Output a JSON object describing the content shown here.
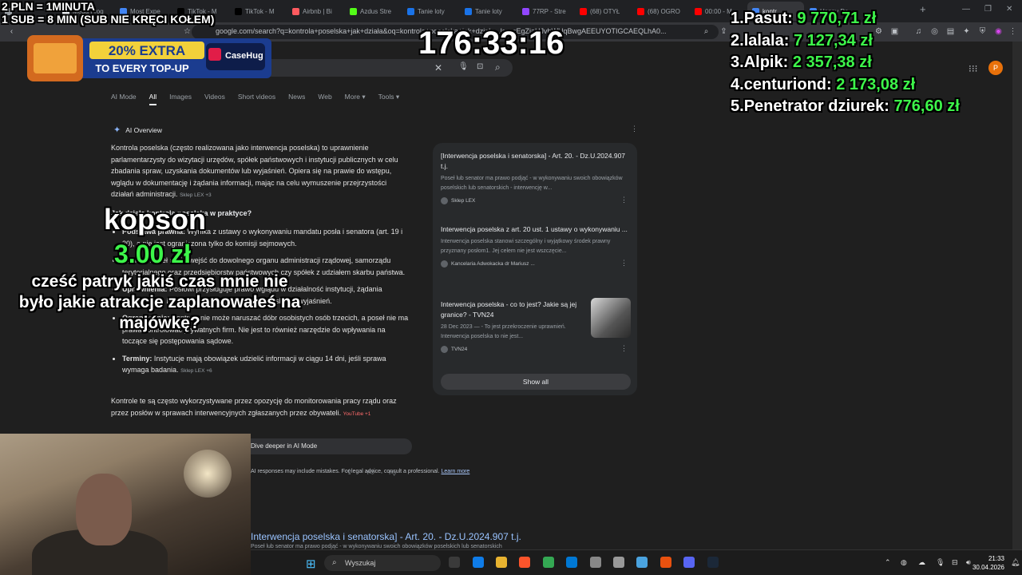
{
  "browser": {
    "tabs": [
      {
        "label": "",
        "color": "#9aa0a6"
      },
      {
        "label": "Mega Frog",
        "color": "#e8eaed"
      },
      {
        "label": "Most Expe",
        "color": "#4285f4"
      },
      {
        "label": "TikTok - M",
        "color": "#000000"
      },
      {
        "label": "TikTok - M",
        "color": "#000000"
      },
      {
        "label": "Airbnb | Bi",
        "color": "#ff5a5f"
      },
      {
        "label": "Azdus Stre",
        "color": "#53fc18"
      },
      {
        "label": "Tanie loty",
        "color": "#1a73e8"
      },
      {
        "label": "Tanie loty",
        "color": "#1a73e8"
      },
      {
        "label": "77RP - Stre",
        "color": "#9146ff"
      },
      {
        "label": "(68) OTYŁ",
        "color": "#ff0000"
      },
      {
        "label": "(68) OGRO",
        "color": "#ff0000"
      },
      {
        "label": "00:00 - M",
        "color": "#ff0000"
      },
      {
        "label": "kontr",
        "color": "#4285f4",
        "active": true
      },
      {
        "label": "Happy Do",
        "color": "#4285f4"
      }
    ],
    "url": "google.com/search?q=kontrola+poselska+jak+działa&oq=kontrola+poselska+jak+działa...lcrp=EgZjaHJvbWUqBwgAEEUYOTIGCAEQLhA0...",
    "new_tab": "+"
  },
  "google": {
    "nav_tabs": [
      "AI Mode",
      "All",
      "Images",
      "Videos",
      "Short videos",
      "News",
      "Web",
      "More ▾",
      "Tools ▾"
    ],
    "ai_overview_title": "AI Overview",
    "intro": "Kontrola poselska (często realizowana jako interwencja poselska) to uprawnienie parlamentarzysty do wizytacji urzędów, spółek państwowych i instytucji publicznych w celu zbadania spraw, uzyskania dokumentów lub wyjaśnień. Opiera się na prawie do wstępu, wglądu w dokumentację i żądania informacji, mając na celu wymuszenie przejrzystości działań administracji.",
    "intro_cite": "Sklep LEX +3",
    "subheading": "Jak działa kontrola poselska w praktyce?",
    "bullets": [
      {
        "term": "Podstawa prawna:",
        "text": "Wynika z ustawy o wykonywaniu mandatu posła i senatora (art. 19 i 20), a nie jest ograniczona tylko do komisji sejmowych."
      },
      {
        "term": "Zakres:",
        "text": "Poseł może wejść do dowolnego organu administracji rządowej, samorządu terytorialnego oraz przedsiębiorstw państwowych czy spółek z udziałem skarbu państwa."
      },
      {
        "term": "Uprawnienia:",
        "text": "Posłowi przysługuje prawo wglądu w działalność instytucji, żądania dokumentów, informacji oraz niezwłocznego uzyskania wyjaśnień."
      },
      {
        "term": "Ograniczenia:",
        "text": "Kontrola nie może naruszać dóbr osobistych osób trzecich, a poseł nie ma prawa kontrolować prywatnych firm. Nie jest to również narzędzie do wpływania na toczące się postępowania sądowe."
      },
      {
        "term": "Terminy:",
        "text": "Instytucje mają obowiązek udzielić informacji w ciągu 14 dni, jeśli sprawa wymaga badania.",
        "cite": "Sklep LEX +6"
      }
    ],
    "closing": "Kontrole te są często wykorzystywane przez opozycję do monitorowania pracy rządu oraz przez posłów w sprawach interwencyjnych zgłaszanych przez obywateli.",
    "closing_cite": "YouTube +1",
    "deeper_label": "Dive deeper in AI Mode",
    "disclaimer": "AI responses may include mistakes. For legal advice, consult a professional.",
    "learn_more": "Learn more",
    "result_title": "Interwencja poselska i senatorska] - Art. 20. - Dz.U.2024.907 t.j.",
    "result_snippet": "Poseł lub senator ma prawo podjąć - w wykonywaniu swoich obowiązków poselskich lub senatorskich",
    "sources": [
      {
        "title": "[Interwencja poselska i senatorska] - Art. 20. - Dz.U.2024.907 t.j.",
        "snippet": "Poseł lub senator ma prawo podjąć - w wykonywaniu swoich obowiązków poselskich lub senatorskich - interwencję w...",
        "origin": "Sklep LEX"
      },
      {
        "title": "Interwencja poselska z art. 20 ust. 1 ustawy o wykonywaniu ...",
        "snippet": "Interwencja poselska stanowi szczególny i wyjątkowy środek prawny przyznany posłom1. Jej celem nie jest wszczęcie...",
        "origin": "Kancelaria Adwokacka dr Mariusz ..."
      },
      {
        "title": "Interwencja poselska - co to jest? Jakie są jej granice? - TVN24",
        "snippet": "28 Dec 2023 — - To jest przekroczenie uprawnień. Interwencja poselska to nie jest...",
        "origin": "TVN24"
      }
    ],
    "show_all": "Show all",
    "avatar_letter": "P"
  },
  "taskbar": {
    "search_placeholder": "Wyszukaj",
    "time": "21:33",
    "date": "30.04.2026",
    "app_colors": [
      "#3a3a3a",
      "#0f7ce8",
      "#e8b330",
      "#fb542b",
      "#34a853",
      "#0078d4",
      "#888888",
      "#999999",
      "#4aa3df",
      "#e8510f",
      "#5865f2",
      "#1b2838"
    ]
  },
  "overlay": {
    "top_info_line1": "2 PLN = 1MINUTA",
    "top_info_line2": "1 SUB = 8 MIN (SUB NIE KRĘCI KOŁEM)",
    "timer": "176:33:16",
    "promo_main": "20% EXTRA",
    "promo_sub": "TO EVERY TOP-UP",
    "promo_brand": "CaseHug",
    "leaderboard": [
      {
        "rank": "1.",
        "name": "Pasut:",
        "amount": "9 770,71 zł"
      },
      {
        "rank": "2.",
        "name": "lalala:",
        "amount": "7 127,34 zł"
      },
      {
        "rank": "3.",
        "name": "Alpik:",
        "amount": "2 357,38 zł"
      },
      {
        "rank": "4.",
        "name": "centuriond:",
        "amount": "2 173,08 zł"
      },
      {
        "rank": "5.",
        "name": "Penetrator dziurek:",
        "amount": "776,60 zł"
      }
    ],
    "donor_name": "kopson",
    "donation_amount": "3.00 zł",
    "donation_message": "cześć patryk jakiś czas mnie nie było jakie atrakcje zaplanowałeś na majówkę?"
  }
}
